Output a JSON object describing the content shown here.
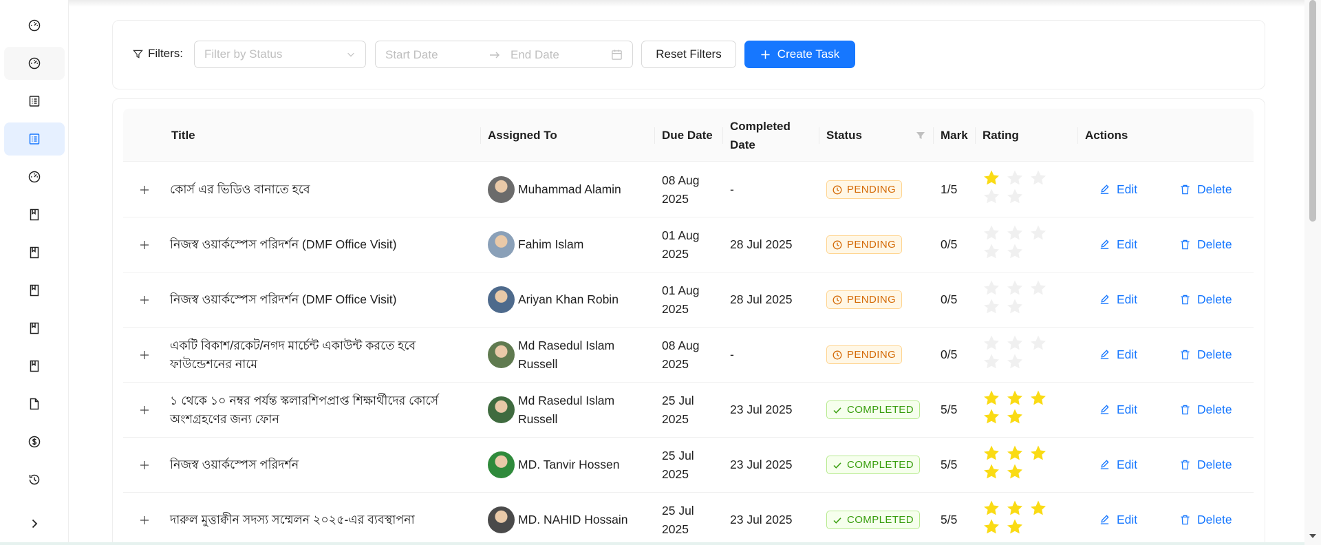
{
  "sidebar": {
    "items": [
      {
        "icon": "dashboard-icon"
      },
      {
        "icon": "dashboard-icon"
      },
      {
        "icon": "list-icon"
      },
      {
        "icon": "list-icon",
        "active": true
      },
      {
        "icon": "dashboard-icon"
      },
      {
        "icon": "book-icon"
      },
      {
        "icon": "book-icon"
      },
      {
        "icon": "book-icon"
      },
      {
        "icon": "book-icon"
      },
      {
        "icon": "book-icon"
      },
      {
        "icon": "file-icon"
      },
      {
        "icon": "dollar-icon"
      },
      {
        "icon": "history-icon"
      }
    ],
    "expand_icon": "chevron-right-icon"
  },
  "filters": {
    "label": "Filters:",
    "status_placeholder": "Filter by Status",
    "start_date_placeholder": "Start Date",
    "end_date_placeholder": "End Date",
    "reset_label": "Reset Filters",
    "create_label": "Create Task"
  },
  "table": {
    "headers": {
      "title": "Title",
      "assigned_to": "Assigned To",
      "due_date": "Due Date",
      "completed_date": "Completed Date",
      "status": "Status",
      "mark": "Mark",
      "rating": "Rating",
      "actions": "Actions"
    },
    "edit_label": "Edit",
    "delete_label": "Delete",
    "rows": [
      {
        "title": "কোর্স এর ভিডিও বানাতে হবে",
        "assignee": "Muhammad Alamin",
        "due": "08 Aug 2025",
        "completed": "-",
        "status": "PENDING",
        "mark": "1/5",
        "rating": 1
      },
      {
        "title": "নিজস্ব ওয়ার্কস্পেস পরিদর্শন (DMF Office Visit)",
        "assignee": "Fahim Islam",
        "due": "01 Aug 2025",
        "completed": "28 Jul 2025",
        "status": "PENDING",
        "mark": "0/5",
        "rating": 0
      },
      {
        "title": "নিজস্ব ওয়ার্কস্পেস পরিদর্শন (DMF Office Visit)",
        "assignee": "Ariyan Khan Robin",
        "due": "01 Aug 2025",
        "completed": "28 Jul 2025",
        "status": "PENDING",
        "mark": "0/5",
        "rating": 0
      },
      {
        "title": "একটি বিকাশ/রকেট/নগদ মার্চেন্ট একাউন্ট করতে হবে ফাউন্ডেশনের নামে",
        "assignee": "Md Rasedul Islam Russell",
        "due": "08 Aug 2025",
        "completed": "-",
        "status": "PENDING",
        "mark": "0/5",
        "rating": 0
      },
      {
        "title": "১ থেকে ১০ নম্বর পর্যন্ত স্কলারশিপপ্রাপ্ত শিক্ষার্থীদের কোর্সে অংশগ্রহণের জন্য ফোন",
        "assignee": "Md Rasedul Islam Russell",
        "due": "25 Jul 2025",
        "completed": "23 Jul 2025",
        "status": "COMPLETED",
        "mark": "5/5",
        "rating": 5
      },
      {
        "title": "নিজস্ব ওয়ার্কস্পেস পরিদর্শন",
        "assignee": "MD. Tanvir Hossen",
        "due": "25 Jul 2025",
        "completed": "23 Jul 2025",
        "status": "COMPLETED",
        "mark": "5/5",
        "rating": 5
      },
      {
        "title": "দারুল মুত্তাক্বীন সদস্য সম্মেলন ২০২৫-এর ব্যবস্থাপনা",
        "assignee": "MD. NAHID Hossain",
        "due": "25 Jul 2025",
        "completed": "23 Jul 2025",
        "status": "COMPLETED",
        "mark": "5/5",
        "rating": 5
      }
    ]
  },
  "colors": {
    "accent": "#1677ff",
    "pending": "#d46b08",
    "completed": "#389e0d",
    "star_filled": "#fadb14",
    "star_empty": "#f0f0f0"
  }
}
